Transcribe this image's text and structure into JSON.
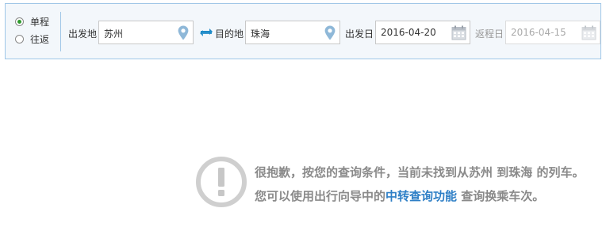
{
  "trip_type": {
    "options": [
      {
        "label": "单程",
        "checked": true
      },
      {
        "label": "往返",
        "checked": false
      }
    ]
  },
  "departure": {
    "label": "出发地",
    "value": "苏州",
    "icon": "map-pin-icon"
  },
  "swap": {
    "icon": "swap-arrows-icon"
  },
  "destination": {
    "label": "目的地",
    "value": "珠海",
    "icon": "map-pin-icon"
  },
  "depart_date": {
    "label": "出发日",
    "value": "2016-04-20",
    "icon": "calendar-icon"
  },
  "return_date": {
    "label": "返程日",
    "value": "2016-04-15",
    "icon": "calendar-icon",
    "disabled": true
  },
  "notice": {
    "icon": "exclamation-circle-icon",
    "text_before": "很抱歉，按您的查询条件，当前未找到从苏州 到珠海 的列车。您可以使用出行向导中的",
    "link_text": "中转查询功能",
    "text_after": " 查询换乘车次。"
  },
  "colors": {
    "accent_blue": "#2e7fc6",
    "panel_border": "#9fc6e7",
    "panel_bg": "#f3f7fb",
    "radio_checked": "#2e9a2e",
    "notice_gray": "#8a8a8a"
  }
}
